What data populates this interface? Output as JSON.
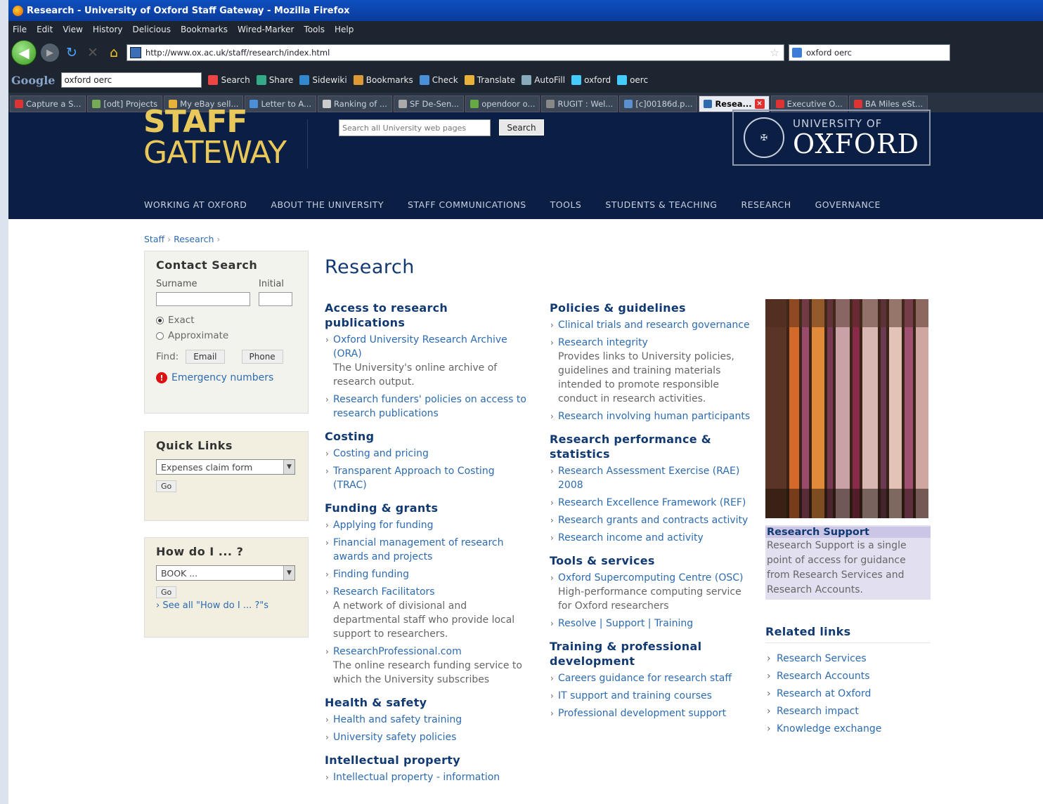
{
  "browser": {
    "window_title": "Research - University of Oxford Staff Gateway - Mozilla Firefox",
    "menu": [
      "File",
      "Edit",
      "View",
      "History",
      "Delicious",
      "Bookmarks",
      "Wired-Marker",
      "Tools",
      "Help"
    ],
    "url": "http://www.ox.ac.uk/staff/research/index.html",
    "search_value": "oxford oerc",
    "google_bar": {
      "logo": "Google",
      "query": "oxford oerc",
      "items": [
        "Search",
        "Share",
        "Sidewiki",
        "Bookmarks",
        "Check",
        "Translate",
        "AutoFill",
        "oxford",
        "oerc"
      ]
    },
    "tabs": [
      {
        "label": "Capture a S...",
        "color": "#d33"
      },
      {
        "label": "[odt] Projects",
        "color": "#7a5"
      },
      {
        "label": "My eBay sell...",
        "color": "#e8b13a"
      },
      {
        "label": "Letter to A...",
        "color": "#4a8fd8"
      },
      {
        "label": "Ranking of ...",
        "color": "#ccc"
      },
      {
        "label": "SF De-Sen...",
        "color": "#aaa"
      },
      {
        "label": "opendoor o...",
        "color": "#6a4"
      },
      {
        "label": "RUGIT : Wel...",
        "color": "#888"
      },
      {
        "label": "[c]00186d.p...",
        "color": "#5a8fd0"
      },
      {
        "label": "Resea...",
        "color": "#2d6bb0",
        "active": true
      },
      {
        "label": "Executive O...",
        "color": "#d33"
      },
      {
        "label": "BA Miles eSt...",
        "color": "#d33"
      }
    ]
  },
  "site": {
    "brand_line1": "STAFF",
    "brand_line2": "GATEWAY",
    "search_placeholder": "Search all University web pages",
    "search_button": "Search",
    "oxford_small": "UNIVERSITY OF",
    "oxford_big": "OXFORD",
    "nav": [
      "WORKING AT OXFORD",
      "ABOUT THE UNIVERSITY",
      "STAFF COMMUNICATIONS",
      "TOOLS",
      "STUDENTS & TEACHING",
      "RESEARCH",
      "GOVERNANCE"
    ],
    "breadcrumb": [
      "Staff",
      "Research"
    ]
  },
  "sidebar": {
    "contact": {
      "title": "Contact Search",
      "surname": "Surname",
      "initial": "Initial",
      "exact": "Exact",
      "approximate": "Approximate",
      "find": "Find:",
      "email": "Email",
      "phone": "Phone",
      "emergency": "Emergency numbers"
    },
    "quick": {
      "title": "Quick Links",
      "selected": "Expenses claim form",
      "go": "Go"
    },
    "howdo": {
      "title": "How do I ... ?",
      "selected": "BOOK ...",
      "go": "Go",
      "see_all": "See all \"How do I ... ?\"s"
    }
  },
  "main": {
    "title": "Research",
    "col1": [
      {
        "heading": "Access to research publications",
        "items": [
          {
            "link": "Oxford University Research Archive (ORA)",
            "desc": "The University's online archive of research output."
          },
          {
            "link": "Research funders' policies on access to research publications",
            "desc": ""
          }
        ]
      },
      {
        "heading": "Costing",
        "items": [
          {
            "link": "Costing and pricing",
            "desc": ""
          },
          {
            "link": "Transparent Approach to Costing (TRAC)",
            "desc": ""
          }
        ]
      },
      {
        "heading": "Funding & grants",
        "items": [
          {
            "link": "Applying for funding",
            "desc": ""
          },
          {
            "link": "Financial management of research awards and projects",
            "desc": ""
          },
          {
            "link": "Finding funding",
            "desc": ""
          },
          {
            "link": "Research Facilitators",
            "desc": "A network of divisional and departmental staff who provide local support to researchers."
          },
          {
            "link": "ResearchProfessional.com",
            "desc": "The online research funding service to which the University subscribes"
          }
        ]
      },
      {
        "heading": "Health & safety",
        "items": [
          {
            "link": "Health and safety training",
            "desc": ""
          },
          {
            "link": "University safety policies",
            "desc": ""
          }
        ]
      },
      {
        "heading": "Intellectual property",
        "items": [
          {
            "link": "Intellectual property - information",
            "desc": ""
          }
        ]
      }
    ],
    "col2": [
      {
        "heading": "Policies & guidelines",
        "items": [
          {
            "link": "Clinical trials and research governance",
            "desc": ""
          },
          {
            "link": "Research integrity",
            "desc": "Provides links to University policies, guidelines and training materials intended to promote responsible conduct in research activities."
          },
          {
            "link": "Research involving human participants",
            "desc": ""
          }
        ]
      },
      {
        "heading": "Research performance & statistics",
        "items": [
          {
            "link": "Research Assessment Exercise (RAE) 2008",
            "desc": ""
          },
          {
            "link": "Research Excellence Framework (REF)",
            "desc": ""
          },
          {
            "link": "Research grants and contracts activity",
            "desc": ""
          },
          {
            "link": "Research income and activity",
            "desc": ""
          }
        ]
      },
      {
        "heading": "Tools & services",
        "items": [
          {
            "link": "Oxford Supercomputing Centre (OSC)",
            "desc": "High-performance computing service for Oxford researchers"
          },
          {
            "link": "Resolve | Support | Training",
            "desc": ""
          }
        ]
      },
      {
        "heading": "Training & professional development",
        "items": [
          {
            "link": "Careers guidance for research staff",
            "desc": ""
          },
          {
            "link": "IT support and training courses",
            "desc": ""
          },
          {
            "link": "Professional development support",
            "desc": ""
          }
        ]
      }
    ]
  },
  "right": {
    "feature_title": "Research Support",
    "feature_text": "Research Support is a single point of access for guidance from Research Services and Research Accounts.",
    "related_title": "Related links",
    "related": [
      "Research Services",
      "Research Accounts",
      "Research at Oxford",
      "Research impact",
      "Knowledge exchange"
    ]
  }
}
